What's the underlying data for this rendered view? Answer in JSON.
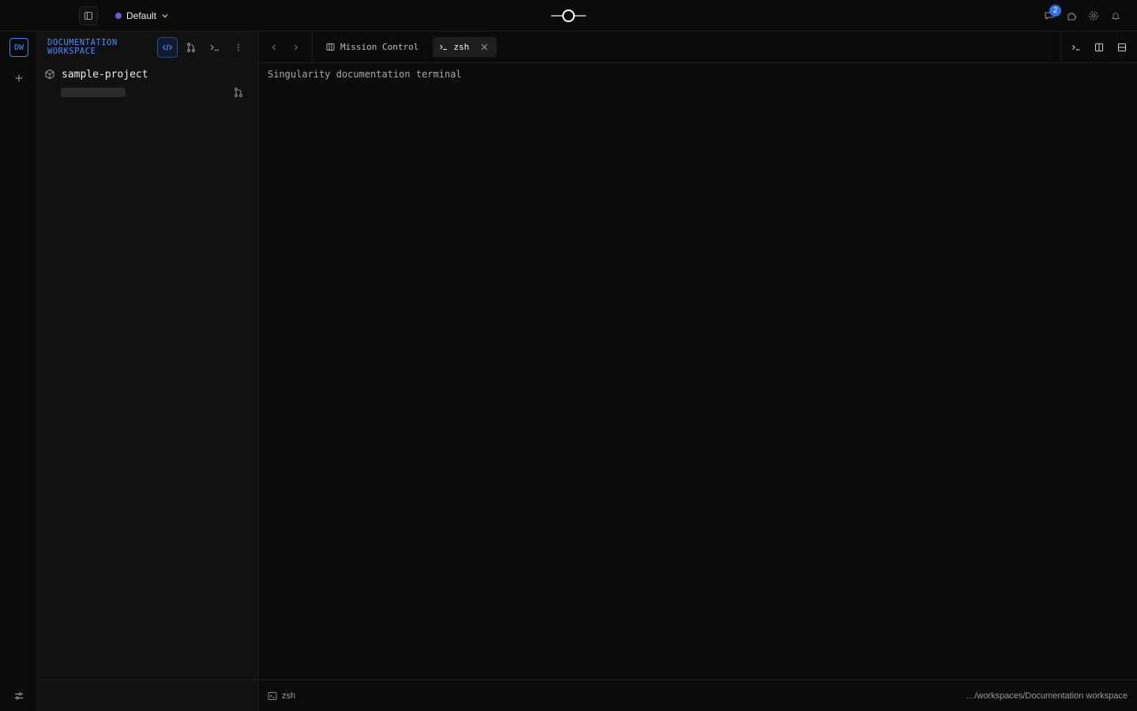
{
  "topbar": {
    "profile_name": "Default",
    "profile_color": "#6b5bd6",
    "notification_count": "2",
    "icons": [
      "sidebar-toggle-icon",
      "chevron-down-icon",
      "app-logo",
      "messages-icon",
      "puzzle-icon",
      "gear-icon",
      "bell-icon"
    ]
  },
  "rail": {
    "workspace_initials": "DW",
    "accent_color": "#3b82f6"
  },
  "explorer": {
    "workspace_title": "DOCUMENTATION WORKSPACE",
    "tools": [
      "code-icon",
      "git-branch-icon",
      "terminal-icon",
      "more-vertical-icon"
    ],
    "project_name": "sample-project"
  },
  "tabs": [
    {
      "label": "Mission Control",
      "icon": "board-icon",
      "active": false
    },
    {
      "label": "zsh",
      "icon": "terminal-icon",
      "active": true
    }
  ],
  "terminal": {
    "output": "Singularity documentation terminal"
  },
  "statusbar": {
    "shell": "zsh",
    "path": "…/workspaces/Documentation workspace"
  }
}
